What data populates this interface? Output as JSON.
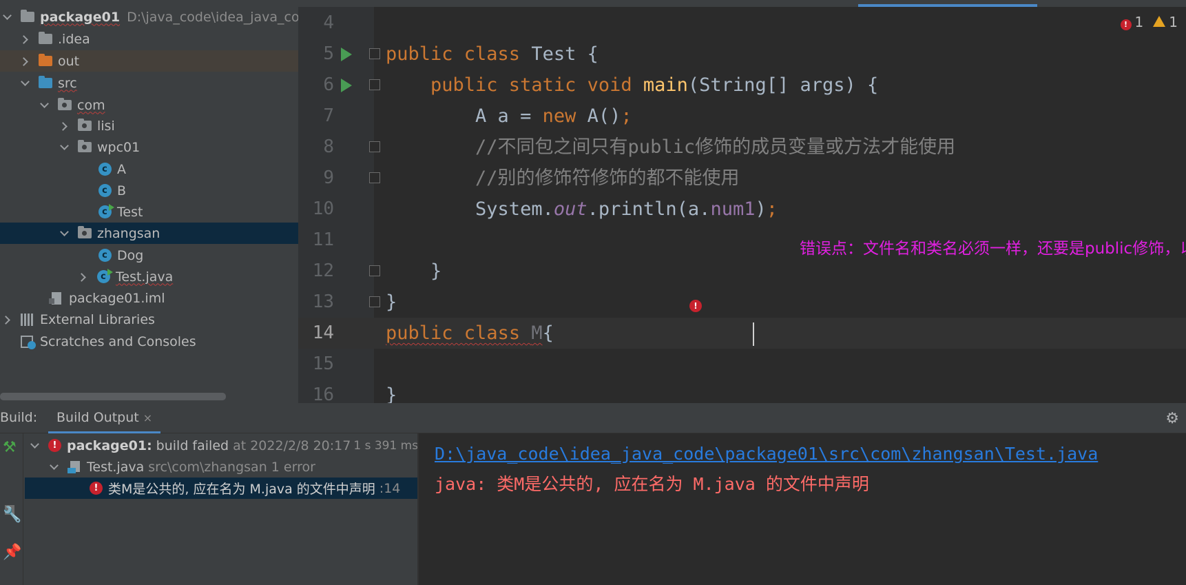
{
  "project_tree": {
    "root": {
      "name": "package01",
      "path": "D:\\java_code\\idea_java_coc"
    },
    "idea": ".idea",
    "out": "out",
    "src": "src",
    "com": "com",
    "lisi": "lisi",
    "wpc01": "wpc01",
    "class_a": "A",
    "class_b": "B",
    "class_test": "Test",
    "zhangsan": "zhangsan",
    "dog": "Dog",
    "test_java": "Test.java",
    "iml": "package01.iml",
    "external_libraries": "External Libraries",
    "scratches": "Scratches and Consoles"
  },
  "editor": {
    "line_numbers": [
      "4",
      "5",
      "6",
      "7",
      "8",
      "9",
      "10",
      "11",
      "12",
      "13",
      "14",
      "15",
      "16"
    ],
    "lines": {
      "l5_kw": "public class ",
      "l5_name": "Test {",
      "l6_kw": "    public static void ",
      "l6_fn": "main",
      "l6_rest": "(String[] args) {",
      "l7_a": "        A a = ",
      "l7_new": "new ",
      "l7_b": "A()",
      "l7_semi": ";",
      "l8": "        //不同包之间只有public修饰的成员变量或方法才能使用",
      "l9": "        //别的修饰符修饰的都不能使用",
      "l10_a": "        System.",
      "l10_out": "out",
      "l10_b": ".println(a.",
      "l10_num": "num1",
      "l10_c": ")",
      "l10_semi": ";",
      "l12": "    }",
      "l13": "}",
      "l14_kw1": "public",
      "l14_kw2": " class ",
      "l14_name": "M",
      "l14_brace": "{",
      "l16": "}"
    },
    "annotation": "错误点：文件名和类名必须一样，还要是public修饰，以下的类不能用public修饰",
    "error_count": "1",
    "warning_count": "1"
  },
  "build": {
    "label": "Build:",
    "tab": "Build Output",
    "tab_close": "×",
    "root_name": "package01:",
    "root_status": "build failed",
    "root_time": "at 2022/2/8 20:17",
    "root_duration": "1 s 391 ms",
    "file_name": "Test.java",
    "file_path": "src\\com\\zhangsan 1 error",
    "error_msg": "类M是公共的, 应在名为 M.java 的文件中声明",
    "error_line": ":14",
    "console_path": "D:\\java_code\\idea_java_code\\package01\\src\\com\\zhangsan\\Test.java",
    "console_msg": "java: 类M是公共的, 应在名为 M.java 的文件中声明"
  },
  "colors": {
    "keyword": "#cc7832",
    "function": "#ffc66d",
    "comment": "#808080",
    "field": "#9876aa",
    "annotation": "#e020e0",
    "error": "#c7222d",
    "link": "#287bde"
  }
}
